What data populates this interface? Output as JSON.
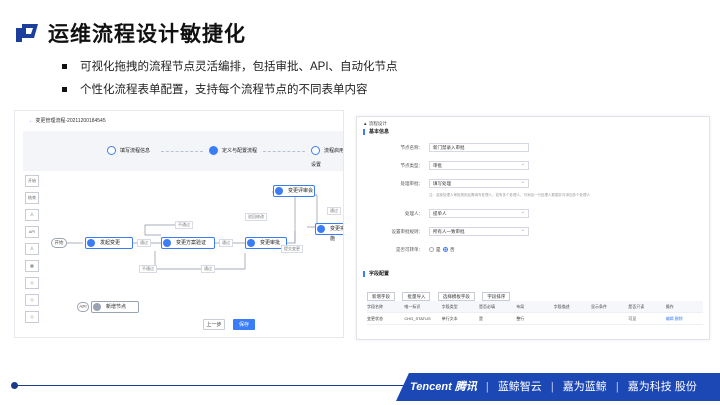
{
  "slide": {
    "title": "运维流程设计敏捷化",
    "bullets": [
      "可视化拖拽的流程节点灵活编排，包括审批、API、自动化节点",
      "个性化流程表单配置，支持每个流程节点的不同表单内容"
    ]
  },
  "left": {
    "header": "变更管理流程-20211200184545",
    "steps": [
      "填写流程信息",
      "定义与配置流程",
      "流程启用设置"
    ],
    "tools": [
      "开始",
      "结束",
      "人",
      "API",
      "人",
      "▦",
      "◇",
      "◇",
      "◇"
    ],
    "nodes": {
      "start": "开始",
      "n1": "发起变更",
      "n2": "变更方案验证",
      "n3": "变更审批",
      "n4": "变更评审会",
      "n5": "变更实施",
      "n6": "新增节点",
      "api": "API"
    },
    "edges": [
      "通过",
      "不通过",
      "不通过",
      "通过",
      "通过",
      "驳回修改",
      "提交变更",
      "通过"
    ],
    "buttons": {
      "prev": "上一步",
      "next": "保存"
    }
  },
  "right": {
    "breadcrumb": "▲ 流程设计",
    "section_basic": "基本信息",
    "form": [
      {
        "label": "节点名称：",
        "value": "新门禁录入审批",
        "type": "input"
      },
      {
        "label": "节点类型：",
        "value": "审批",
        "type": "select"
      },
      {
        "label": "处理审批：",
        "value": "填写处理",
        "type": "select"
      },
      {
        "label": "处理人：",
        "value": "提单人",
        "type": "select"
      },
      {
        "label": "设置审批规则：",
        "value": "所有人一致审批",
        "type": "select"
      }
    ],
    "hint": "注：选择处理人审批规则后需填写处理人，如有多个处理人，可添加一行处理人数据并可添加多个处理人",
    "radio_label": "是否可转单：",
    "radio_options": [
      "是",
      "否"
    ],
    "section_fields": "字段配置",
    "actions": [
      "新增字段",
      "批量导入",
      "选择模板字段",
      "字段排序"
    ],
    "table_headers": [
      "字段名称",
      "唯一标识",
      "字段类型",
      "是否必填",
      "布局",
      "字段描述",
      "显示条件",
      "是否只读",
      "操作"
    ],
    "table_row": [
      "变更状态",
      "CHG_STATUS",
      "单行文本",
      "是",
      "整行",
      "",
      "",
      "可见",
      "编辑 删除"
    ]
  },
  "footer": {
    "brands": [
      "Tencent 腾讯",
      "|",
      "蓝鲸智云",
      "|",
      "嘉为蓝鲸",
      "|",
      "嘉为科技 股份"
    ]
  },
  "colors": {
    "accent": "#3b7df7",
    "footer_blue": "#1c48b6"
  }
}
